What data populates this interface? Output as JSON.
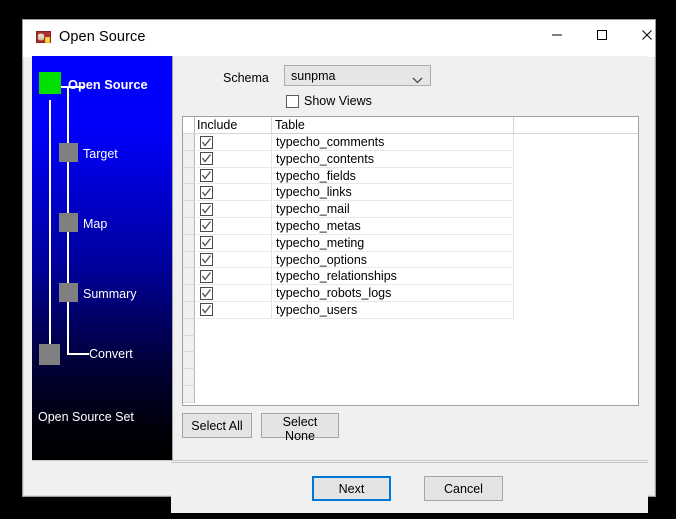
{
  "window": {
    "title": "Open Source",
    "icon": "database-app-icon",
    "controls": {
      "minimize": "minimize-icon",
      "maximize": "maximize-icon",
      "close": "close-icon"
    }
  },
  "sidebar": {
    "steps": [
      {
        "label": "Open Source",
        "state": "active"
      },
      {
        "label": "Target",
        "state": "pending"
      },
      {
        "label": "Map",
        "state": "pending"
      },
      {
        "label": "Summary",
        "state": "pending"
      },
      {
        "label": "Convert",
        "state": "pending"
      }
    ],
    "footer_text": "Open Source Set",
    "colors": {
      "top": "#0000ff",
      "bottom": "#000000",
      "active_marker": "#00e000",
      "pending_marker": "#808080",
      "text": "#ffffff"
    }
  },
  "main": {
    "schema": {
      "label": "Schema",
      "value": "sunpma",
      "arrow_icon": "chevron-down-icon"
    },
    "show_views": {
      "label": "Show Views",
      "checked": false
    },
    "grid": {
      "columns": [
        "Include",
        "Table"
      ],
      "rows": [
        {
          "include": true,
          "table": "typecho_comments"
        },
        {
          "include": true,
          "table": "typecho_contents"
        },
        {
          "include": true,
          "table": "typecho_fields"
        },
        {
          "include": true,
          "table": "typecho_links"
        },
        {
          "include": true,
          "table": "typecho_mail"
        },
        {
          "include": true,
          "table": "typecho_metas"
        },
        {
          "include": true,
          "table": "typecho_meting"
        },
        {
          "include": true,
          "table": "typecho_options"
        },
        {
          "include": true,
          "table": "typecho_relationships"
        },
        {
          "include": true,
          "table": "typecho_robots_logs"
        },
        {
          "include": true,
          "table": "typecho_users"
        }
      ],
      "empty_row_count": 5
    },
    "selection_buttons": {
      "select_all": "Select All",
      "select_none": "Select None"
    }
  },
  "footer": {
    "next": "Next",
    "cancel": "Cancel",
    "focus_color": "#0078d7"
  }
}
